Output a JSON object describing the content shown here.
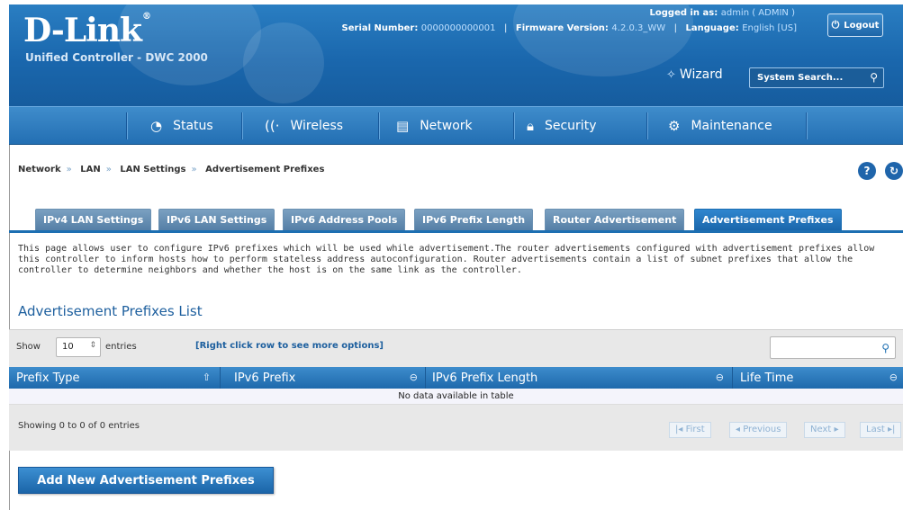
{
  "header": {
    "logo_text": "D-Link",
    "logo_reg": "®",
    "subtitle": "Unified Controller - DWC 2000",
    "logged_in_label": "Logged in as:",
    "logged_in_user": "admin ( ADMIN )",
    "logout_label": "Logout",
    "serial_label": "Serial Number:",
    "serial_value": "0000000000001",
    "firmware_label": "Firmware Version:",
    "firmware_value": "4.2.0.3_WW",
    "language_label": "Language:",
    "language_value": "English [US]",
    "wizard_label": "Wizard",
    "search_placeholder": "System Search..."
  },
  "nav": {
    "items": [
      {
        "label": "Status",
        "icon": "gauge-icon"
      },
      {
        "label": "Wireless",
        "icon": "wifi-icon"
      },
      {
        "label": "Network",
        "icon": "monitor-icon"
      },
      {
        "label": "Security",
        "icon": "lock-icon"
      },
      {
        "label": "Maintenance",
        "icon": "gears-icon"
      }
    ]
  },
  "breadcrumb": [
    "Network",
    "LAN",
    "LAN Settings",
    "Advertisement Prefixes"
  ],
  "tabs": [
    {
      "label": "IPv4 LAN Settings",
      "active": false
    },
    {
      "label": "IPv6 LAN Settings",
      "active": false
    },
    {
      "label": "IPv6 Address Pools",
      "active": false
    },
    {
      "label": "IPv6 Prefix Length",
      "active": false
    },
    {
      "label": "Router Advertisement",
      "active": false
    },
    {
      "label": "Advertisement Prefixes",
      "active": true
    }
  ],
  "description": "This page allows user to configure IPv6 prefixes which will be used while advertisement.The router advertisements configured with advertisement prefixes allow this controller to inform hosts how to perform stateless address autoconfiguration. Router advertisements contain a list of subnet prefixes that allow the controller to determine neighbors and whether the host is on the same link as the controller.",
  "section_title": "Advertisement Prefixes List",
  "table": {
    "show_label": "Show",
    "entries_value": "10",
    "entries_label": "entries",
    "right_click_hint": "[Right click row to see more options]",
    "columns": [
      "Prefix Type",
      "IPv6 Prefix",
      "IPv6 Prefix Length",
      "Life Time"
    ],
    "empty_message": "No data available in table",
    "showing_text": "Showing 0 to 0 of 0 entries",
    "pager": {
      "first": "First",
      "previous": "Previous",
      "next": "Next",
      "last": "Last"
    }
  },
  "add_button_label": "Add New Advertisement Prefixes",
  "colors": {
    "accent": "#1d6fb2",
    "title": "#1d5f9e",
    "help": "#1f65ab"
  }
}
